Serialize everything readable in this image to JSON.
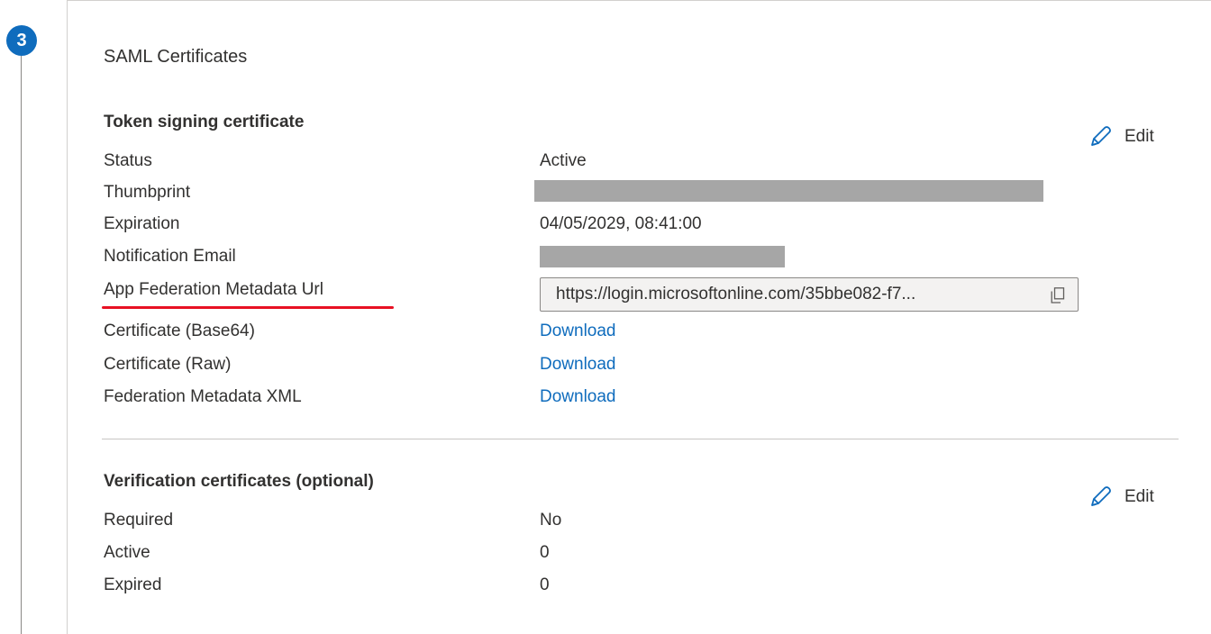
{
  "step": {
    "number": "3"
  },
  "section": {
    "title": "SAML Certificates"
  },
  "token_signing": {
    "heading": "Token signing certificate",
    "edit_label": "Edit",
    "rows": {
      "status": {
        "label": "Status",
        "value": "Active"
      },
      "thumbprint": {
        "label": "Thumbprint",
        "value": ""
      },
      "expiration": {
        "label": "Expiration",
        "value": "04/05/2029, 08:41:00"
      },
      "notification_email": {
        "label": "Notification Email",
        "value": ""
      },
      "app_federation_metadata_url": {
        "label": "App Federation Metadata Url",
        "value": "https://login.microsoftonline.com/35bbe082-f7..."
      },
      "certificate_base64": {
        "label": "Certificate (Base64)",
        "value": "Download"
      },
      "certificate_raw": {
        "label": "Certificate (Raw)",
        "value": "Download"
      },
      "federation_metadata_xml": {
        "label": "Federation Metadata XML",
        "value": "Download"
      }
    }
  },
  "verification": {
    "heading": "Verification certificates (optional)",
    "edit_label": "Edit",
    "rows": {
      "required": {
        "label": "Required",
        "value": "No"
      },
      "active": {
        "label": "Active",
        "value": "0"
      },
      "expired": {
        "label": "Expired",
        "value": "0"
      }
    }
  },
  "icons": {
    "edit": "pencil-icon",
    "copy": "copy-icon"
  },
  "colors": {
    "accent": "#0f6cbd",
    "highlight_underline": "#e81123",
    "redacted": "#a6a6a6"
  }
}
